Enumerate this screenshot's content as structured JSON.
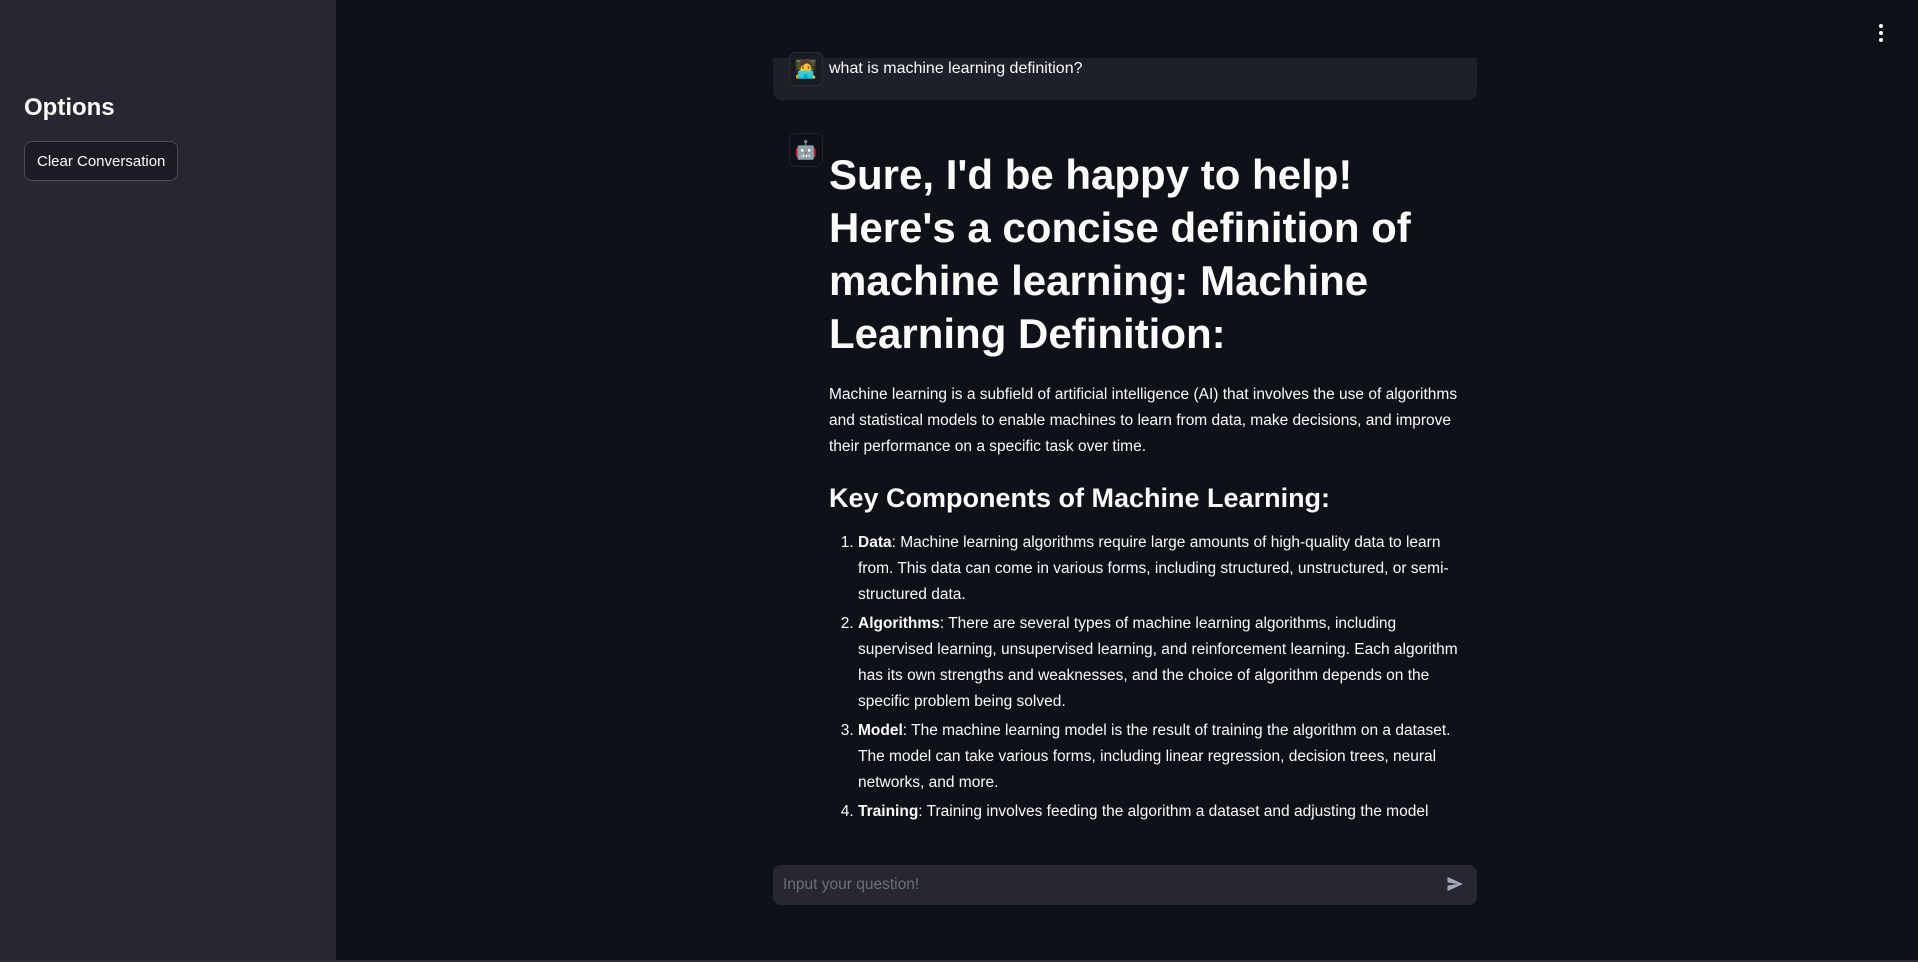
{
  "sidebar": {
    "title": "Options",
    "clear_button_label": "Clear Conversation"
  },
  "menu": {
    "icon": "kebab-menu-icon"
  },
  "chat": {
    "user_message": {
      "avatar": "🧑‍💻",
      "text": "what is machine learning definition?"
    },
    "bot_message": {
      "avatar": "🤖",
      "heading": "Sure, I'd be happy to help! Here's a concise definition of machine learning: Machine Learning Definition:",
      "paragraph": "Machine learning is a subfield of artificial intelligence (AI) that involves the use of algorithms and statistical models to enable machines to learn from data, make decisions, and improve their performance on a specific task over time.",
      "subheading": "Key Components of Machine Learning:",
      "list": [
        {
          "term": "Data",
          "text": ": Machine learning algorithms require large amounts of high-quality data to learn from. This data can come in various forms, including structured, unstructured, or semi-structured data."
        },
        {
          "term": "Algorithms",
          "text": ": There are several types of machine learning algorithms, including supervised learning, unsupervised learning, and reinforcement learning. Each algorithm has its own strengths and weaknesses, and the choice of algorithm depends on the specific problem being solved."
        },
        {
          "term": "Model",
          "text": ": The machine learning model is the result of training the algorithm on a dataset. The model can take various forms, including linear regression, decision trees, neural networks, and more."
        },
        {
          "term": "Training",
          "text": ": Training involves feeding the algorithm a dataset and adjusting the model"
        }
      ]
    }
  },
  "input": {
    "placeholder": "Input your question!",
    "value": "",
    "send_icon": "send-icon"
  },
  "colors": {
    "background": "#0e1117",
    "sidebar": "#262730",
    "input_bg": "#262730",
    "text": "#fafafa"
  }
}
